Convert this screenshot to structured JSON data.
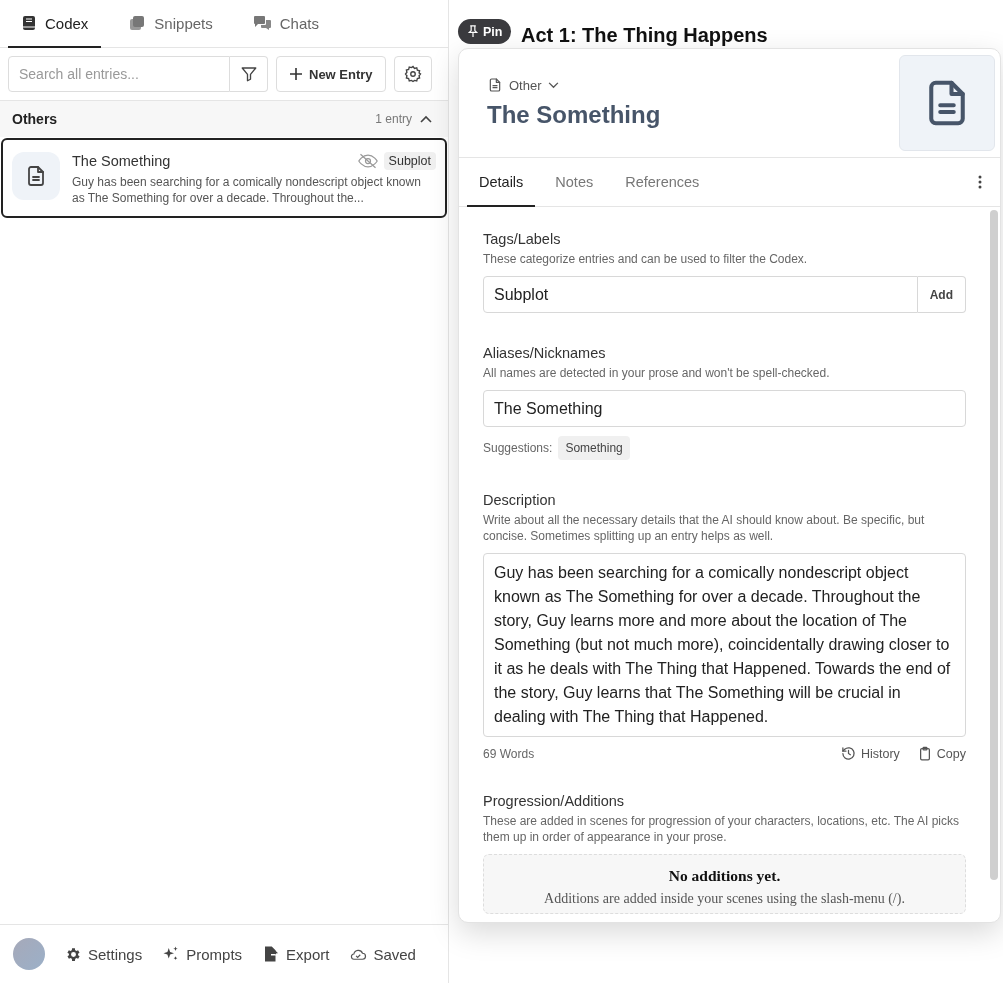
{
  "sidebar": {
    "tabs": [
      {
        "kind": "codex",
        "label": "Codex",
        "selected": true
      },
      {
        "kind": "snippets",
        "label": "Snippets",
        "selected": false
      },
      {
        "kind": "chats",
        "label": "Chats",
        "selected": false
      }
    ],
    "search": {
      "placeholder": "Search all entries..."
    },
    "new_entry_button": "New Entry",
    "groups": [
      {
        "title": "Others",
        "count": "1 entry",
        "expanded": true,
        "entries": [
          {
            "title": "The Something",
            "tag": "Subplot",
            "selected": true,
            "summary": "Guy has been searching for a comically nondescript object known as The Something for over a decade. Throughout the..."
          }
        ]
      }
    ],
    "footer": [
      {
        "kind": "settings",
        "label": "Settings"
      },
      {
        "kind": "prompts",
        "label": "Prompts"
      },
      {
        "kind": "export",
        "label": "Export"
      },
      {
        "kind": "saved",
        "label": "Saved"
      }
    ]
  },
  "background": {
    "heading": "Act 1: The Thing Happens"
  },
  "pin_button": "Pin",
  "entry": {
    "category": "Other",
    "title": "The Something",
    "tabs": [
      {
        "label": "Details",
        "selected": true
      },
      {
        "label": "Notes",
        "selected": false
      },
      {
        "label": "References",
        "selected": false
      }
    ],
    "tags": {
      "label": "Tags/Labels",
      "hint": "These categorize entries and can be used to filter the Codex.",
      "value": "Subplot",
      "add_button": "Add"
    },
    "aliases": {
      "label": "Aliases/Nicknames",
      "hint": "All names are detected in your prose and won't be spell-checked.",
      "value": "The Something",
      "suggestions_label": "Suggestions:",
      "suggestions": [
        "Something"
      ]
    },
    "description": {
      "label": "Description",
      "hint": "Write about all the necessary details that the AI should know about. Be specific, but concise. Sometimes splitting up an entry helps as well.",
      "text": "Guy has been searching for a comically nondescript object known as The Something for over a decade. Throughout the story, Guy learns more and more about the location of The Something (but not much more), coincidentally drawing closer to it as he deals with The Thing that Happened. Towards the end of the story, Guy learns that The Something will be crucial in dealing with The Thing that Happened.",
      "word_count": "69 Words",
      "actions": [
        {
          "kind": "history",
          "label": "History"
        },
        {
          "kind": "copy",
          "label": "Copy"
        }
      ]
    },
    "progression": {
      "label": "Progression/Additions",
      "hint": "These are added in scenes for progression of your characters, locations, etc. The AI picks them up in order of appearance in your prose.",
      "empty_title": "No additions yet.",
      "empty_text": "Additions are added inside your scenes using the slash-menu (/)."
    }
  }
}
